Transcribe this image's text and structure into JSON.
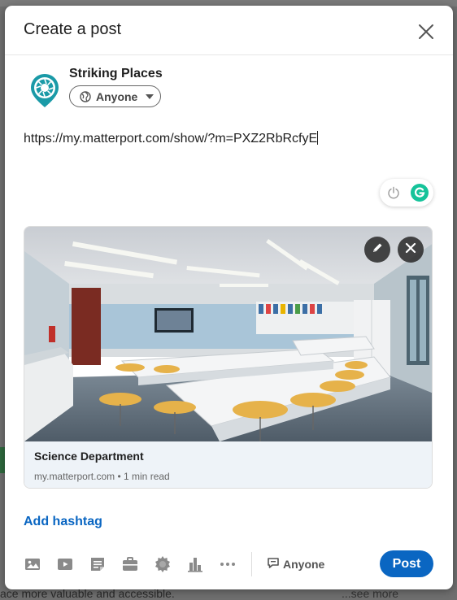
{
  "dialog": {
    "title": "Create a post"
  },
  "author": {
    "name": "Striking Places",
    "visibility": "Anyone"
  },
  "composer": {
    "text": "https://my.matterport.com/show/?m=PXZ2RbRcfyE"
  },
  "link_preview": {
    "title": "Science Department",
    "source": "my.matterport.com",
    "read_time": "1 min read",
    "separator": " • "
  },
  "actions": {
    "add_hashtag": "Add hashtag",
    "comment_setting": "Anyone",
    "post_label": "Post"
  },
  "background": {
    "footer_left": "ace more valuable and accessible.",
    "footer_right": "...see more"
  },
  "icons": {
    "close": "close-icon",
    "globe": "globe-icon",
    "caret": "caret-down-icon",
    "grammarly": "grammarly-icon",
    "power": "power-icon",
    "edit": "pencil-icon",
    "remove": "close-icon",
    "toolbar": [
      "photo-icon",
      "video-icon",
      "document-icon",
      "job-icon",
      "celebrate-icon",
      "poll-icon",
      "more-icon"
    ],
    "comment": "comment-icon"
  },
  "colors": {
    "brand": "#0a66c2",
    "grammarly": "#15c39a",
    "preview_meta_bg": "#eef3f8"
  }
}
